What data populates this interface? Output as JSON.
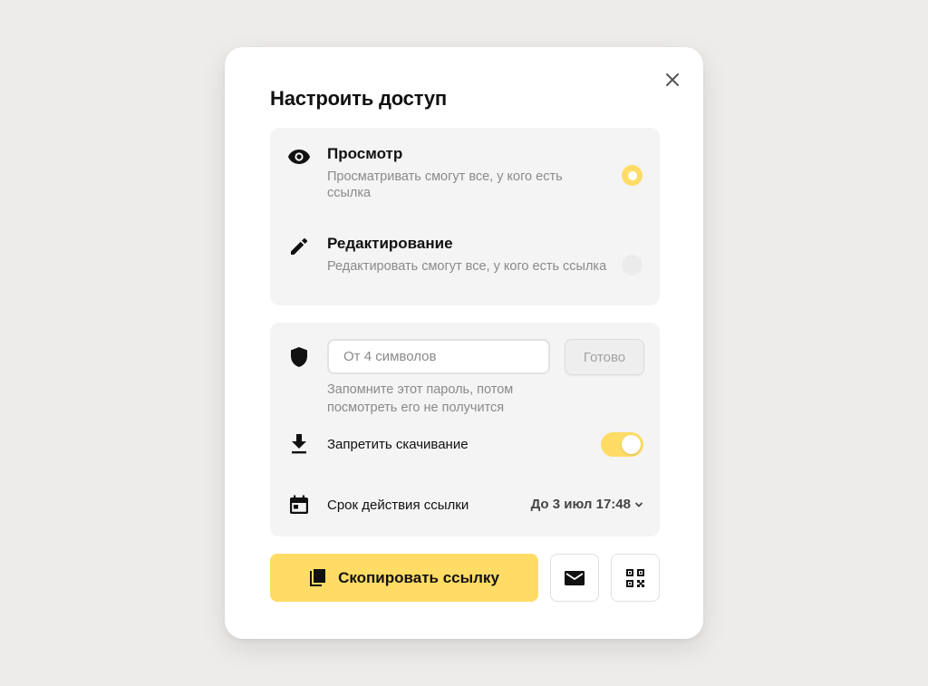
{
  "dialog": {
    "title": "Настроить доступ",
    "close_icon": "close-icon"
  },
  "access": {
    "view": {
      "icon": "eye-icon",
      "title": "Просмотр",
      "description": "Просматривать смогут все, у кого есть ссылка",
      "selected": true
    },
    "edit": {
      "icon": "pencil-icon",
      "title": "Редактирование",
      "description": "Редактировать смогут все, у кого есть ссылка",
      "selected": false
    }
  },
  "password": {
    "icon": "shield-icon",
    "placeholder": "От 4 символов",
    "value": "",
    "done_label": "Готово",
    "hint": "Запомните этот пароль, потом посмотреть его не получится"
  },
  "download": {
    "icon": "download-icon",
    "label": "Запретить скачивание",
    "enabled": true
  },
  "expiry": {
    "icon": "calendar-icon",
    "label": "Срок действия ссылки",
    "value": "До 3 июл 17:48",
    "chevron_icon": "chevron-down-icon"
  },
  "actions": {
    "copy_label": "Скопировать ссылку",
    "copy_icon": "copy-icon",
    "mail_icon": "mail-icon",
    "qr_icon": "qr-code-icon"
  },
  "colors": {
    "accent": "#ffdc66",
    "background": "#edecea",
    "panel": "#f4f4f4",
    "muted_text": "#8a8a8a"
  }
}
